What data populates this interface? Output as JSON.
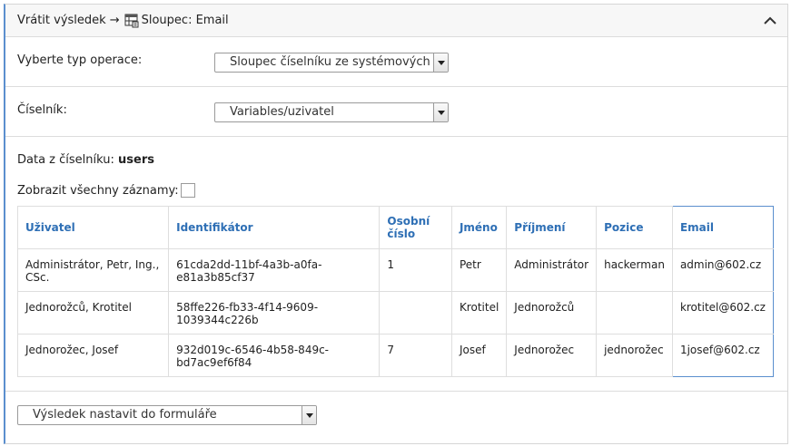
{
  "header": {
    "back_label": "Vrátit výsledek",
    "arrow": "→",
    "title": "Sloupec: Email"
  },
  "operation": {
    "label": "Vyberte typ operace:",
    "selected": "Sloupec číselníku ze systémových dat"
  },
  "codelist": {
    "label": "Číselník:",
    "selected": "Variables/uzivatel"
  },
  "data": {
    "title_prefix": "Data z číselníku:",
    "title_name": "users",
    "show_all_label": "Zobrazit všechny záznamy:"
  },
  "table": {
    "columns": [
      "Uživatel",
      "Identifikátor",
      "Osobní číslo",
      "Jméno",
      "Příjmení",
      "Pozice",
      "Email"
    ],
    "rows": [
      [
        "Administrátor, Petr, Ing., CSc.",
        "61cda2dd-11bf-4a3b-a0fa-e81a3b85cf37",
        "1",
        "Petr",
        "Administrátor",
        "hackerman",
        "admin@602.cz"
      ],
      [
        "Jednorožců, Krotitel",
        "58ffe226-fb33-4f14-9609-1039344c226b",
        "",
        "Krotitel",
        "Jednorožců",
        "",
        "krotitel@602.cz"
      ],
      [
        "Jednorožec, Josef",
        "932d019c-6546-4b58-849c-bd7ac9ef6f84",
        "7",
        "Josef",
        "Jednorožec",
        "jednorožec",
        "1josef@602.cz"
      ]
    ]
  },
  "footer": {
    "selected": "Výsledek nastavit do formuláře"
  },
  "colors": {
    "accent": "#5b8fce",
    "header_text": "#2e6fb5"
  }
}
